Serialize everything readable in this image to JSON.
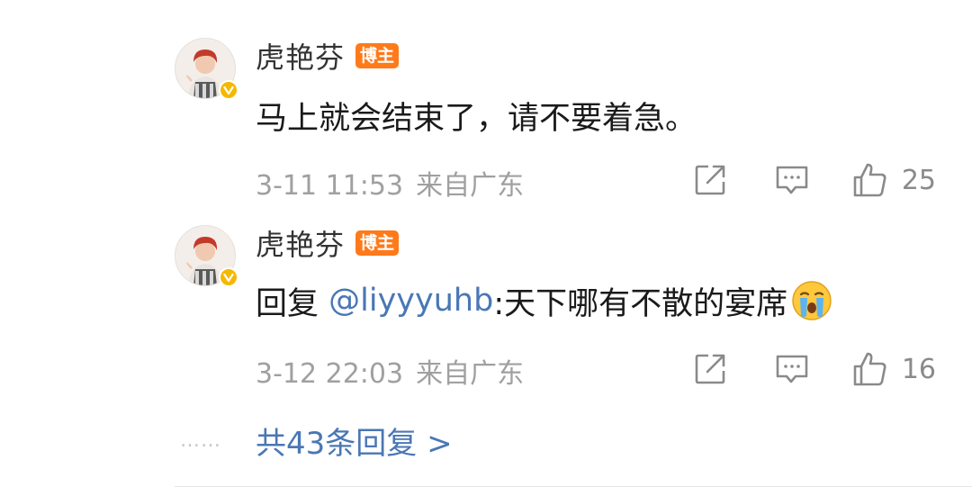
{
  "replies": [
    {
      "username": "虎艳芬",
      "badge": "博主",
      "text": "马上就会结束了，请不要着急。",
      "date": "3-11 11:53",
      "location": "来自广东",
      "likes": "25"
    },
    {
      "username": "虎艳芬",
      "badge": "博主",
      "reply_prefix": "回复 ",
      "mention": "@liyyyuhb",
      "text": ":天下哪有不散的宴席",
      "emoji": "crying-face",
      "date": "3-12 22:03",
      "location": "来自广东",
      "likes": "16"
    }
  ],
  "footer": {
    "dots": "……",
    "more_replies": "共43条回复 >"
  },
  "colors": {
    "badge": "#ff7a1a",
    "link": "#4a77b5",
    "meta": "#a0a0a0",
    "verified": "#f5b800"
  }
}
